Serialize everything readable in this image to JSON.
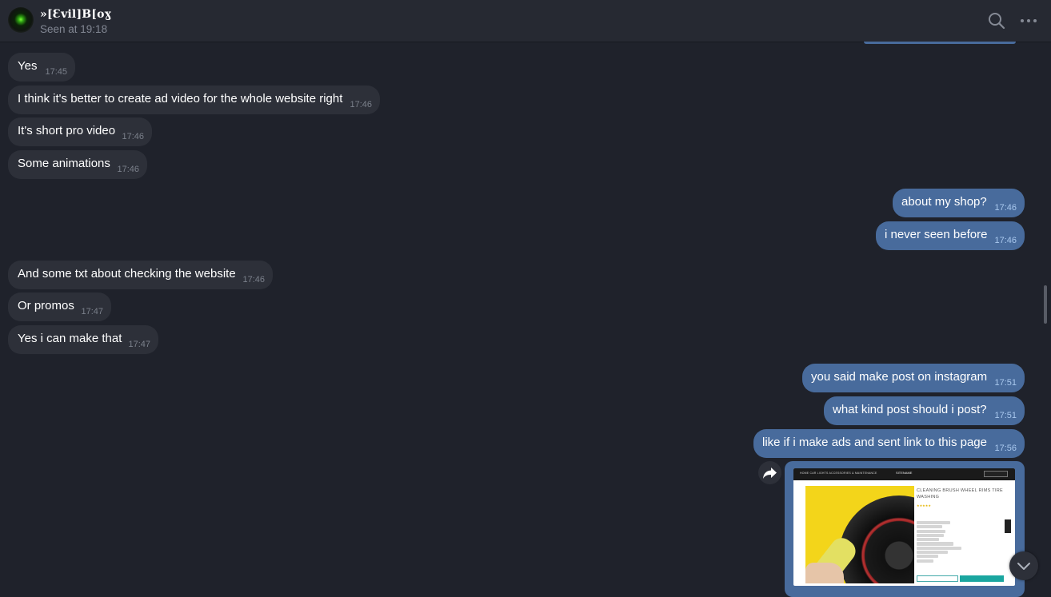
{
  "header": {
    "contact_name": "»[Ɛvil]B[oɣ",
    "status": "Seen at 19:18",
    "search_icon": "search-icon",
    "more_icon": "more-options-icon"
  },
  "messages": [
    {
      "dir": "in",
      "text": "Yes",
      "time": "17:45"
    },
    {
      "dir": "in",
      "text": "I think it's better to create ad video for the whole website right",
      "time": "17:46"
    },
    {
      "dir": "in",
      "text": "It's short pro video",
      "time": "17:46"
    },
    {
      "dir": "in",
      "text": "Some animations",
      "time": "17:46"
    },
    {
      "dir": "out",
      "text": "about my shop?",
      "time": "17:46"
    },
    {
      "dir": "out",
      "text": "i never seen before",
      "time": "17:46"
    },
    {
      "dir": "in",
      "text": "And some txt about checking the website",
      "time": "17:46"
    },
    {
      "dir": "in",
      "text": "Or promos",
      "time": "17:47"
    },
    {
      "dir": "in",
      "text": "Yes i can make that",
      "time": "17:47"
    },
    {
      "dir": "out",
      "text": "you said make post on instagram",
      "time": "17:51"
    },
    {
      "dir": "out",
      "text": "what kind post should i post?",
      "time": "17:51"
    },
    {
      "dir": "out",
      "text": "like if i make ads and sent link to this page",
      "time": "17:56"
    }
  ],
  "image_message": {
    "product_title": "CLEANING BRUSH WHEEL RIMS TIRE WASHING",
    "nav_text": "HOME   CAR LIGHTS   ACCESSORIES & MAINTENANCE",
    "site_logo": "SITENAME",
    "share_icon": "share-icon"
  },
  "controls": {
    "scroll_down_icon": "chevron-down-icon"
  },
  "colors": {
    "background": "#1f222b",
    "header": "#262932",
    "incoming_bubble": "#2d3039",
    "outgoing_bubble": "#486b9c"
  }
}
